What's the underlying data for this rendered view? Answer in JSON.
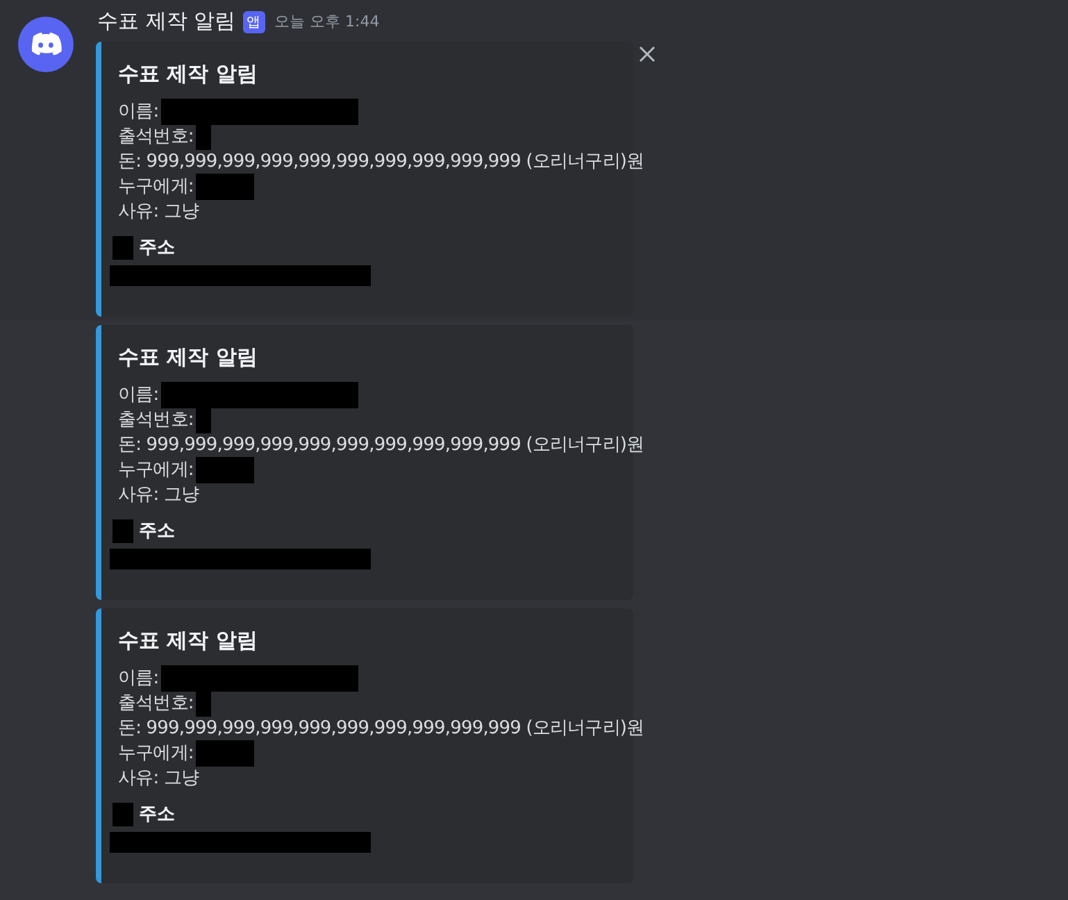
{
  "message": {
    "author": "수표 제작 알림",
    "badge": "앱",
    "timestamp": "오늘 오후 1:44"
  },
  "embeds": [
    {
      "hovered": true,
      "title": "수표 제작 알림",
      "lines": [
        {
          "label": "이름:",
          "redacted": true
        },
        {
          "label": "출석번호:",
          "redacted": true
        },
        {
          "label": "돈: 999,999,999,999,999,999,999,999,999,999 (오리너구리)원",
          "redacted": false
        },
        {
          "label": "누구에게:",
          "redacted": true
        },
        {
          "label": "사유: 그냥",
          "redacted": false
        }
      ],
      "field_name": "주소"
    },
    {
      "hovered": false,
      "title": "수표 제작 알림",
      "lines": [
        {
          "label": "이름:",
          "redacted": true
        },
        {
          "label": "출석번호:",
          "redacted": true
        },
        {
          "label": "돈: 999,999,999,999,999,999,999,999,999,999 (오리너구리)원",
          "redacted": false
        },
        {
          "label": "누구에게:",
          "redacted": true
        },
        {
          "label": "사유: 그냥",
          "redacted": false
        }
      ],
      "field_name": "주소"
    },
    {
      "hovered": false,
      "title": "수표 제작 알림",
      "lines": [
        {
          "label": "이름:",
          "redacted": true
        },
        {
          "label": "출석번호:",
          "redacted": true
        },
        {
          "label": "돈: 999,999,999,999,999,999,999,999,999,999 (오리너구리)원",
          "redacted": false
        },
        {
          "label": "누구에게:",
          "redacted": true
        },
        {
          "label": "사유: 그냥",
          "redacted": false
        }
      ],
      "field_name": "주소"
    }
  ]
}
